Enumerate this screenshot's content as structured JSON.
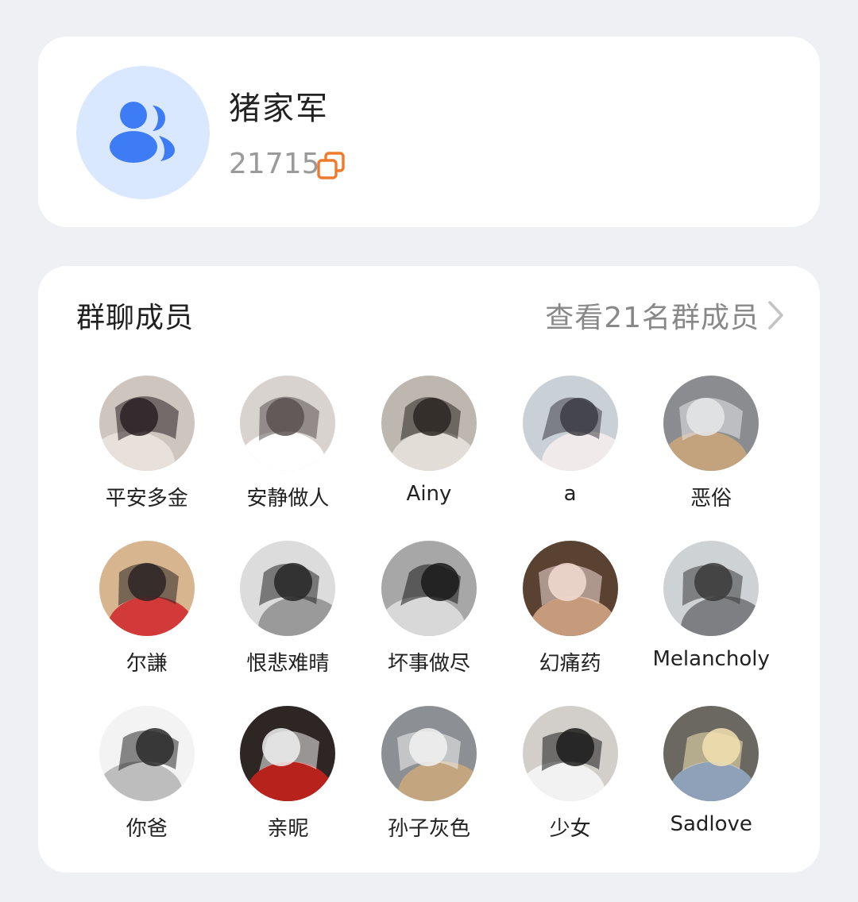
{
  "group": {
    "name": "猪家军",
    "id": "21715",
    "avatar_icon": "group-people-icon",
    "copy_icon": "copy-icon",
    "accent_color": "#3d7cf5",
    "copy_color": "#f07a2b"
  },
  "members_section": {
    "title": "群聊成员",
    "view_all_label": "查看21名群成员",
    "chevron_icon": "chevron-right-icon",
    "members": [
      {
        "name": "平安多金",
        "bg": "#cfc5bf",
        "fg": "#2a1f22",
        "accent": "#e8e0db"
      },
      {
        "name": "安静做人",
        "bg": "#d9d3cf",
        "fg": "#5a5050",
        "accent": "#ffffff"
      },
      {
        "name": "Ainy",
        "bg": "#bdb7b0",
        "fg": "#2c2623",
        "accent": "#e2ddd6"
      },
      {
        "name": "a",
        "bg": "#c9d0d6",
        "fg": "#3c3d44",
        "accent": "#f1eaea"
      },
      {
        "name": "恶俗",
        "bg": "#8a8c90",
        "fg": "#e6e8ea",
        "accent": "#c2a37e"
      },
      {
        "name": "尔謙",
        "bg": "#d6b58f",
        "fg": "#2b2424",
        "accent": "#d23a3a"
      },
      {
        "name": "恨悲难晴",
        "bg": "#dcdcdc",
        "fg": "#262626",
        "accent": "#9a9a9a"
      },
      {
        "name": "坏事做尽",
        "bg": "#a7a7a7",
        "fg": "#1a1a1a",
        "accent": "#d8d8d8"
      },
      {
        "name": "幻痛药",
        "bg": "#5a4233",
        "fg": "#f3ddd3",
        "accent": "#c59b7c"
      },
      {
        "name": "Melancholy",
        "bg": "#cfd2d4",
        "fg": "#3a3a3a",
        "accent": "#7d7f82"
      },
      {
        "name": "你爸",
        "bg": "#f3f3f3",
        "fg": "#2a2a2a",
        "accent": "#bdbdbd"
      },
      {
        "name": "亲昵",
        "bg": "#2e2624",
        "fg": "#f0f0f0",
        "accent": "#b8221c"
      },
      {
        "name": "孙子灰色",
        "bg": "#8c8f93",
        "fg": "#f2f2f2",
        "accent": "#c3a57f"
      },
      {
        "name": "少女",
        "bg": "#d2cfcb",
        "fg": "#1c1c1c",
        "accent": "#f2f2f2"
      },
      {
        "name": "Sadlove",
        "bg": "#6b6862",
        "fg": "#f2e2b0",
        "accent": "#8fa1b8"
      }
    ]
  }
}
